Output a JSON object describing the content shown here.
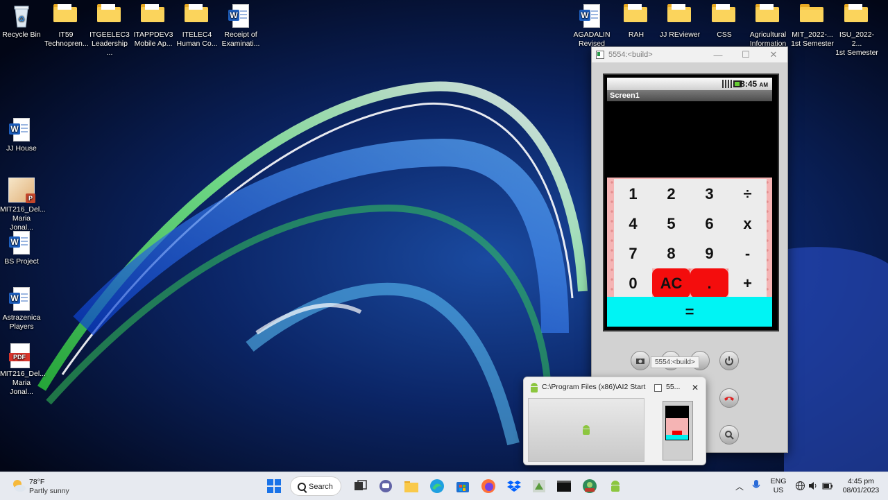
{
  "desktop_icons_top": [
    {
      "label1": "Recycle Bin",
      "label2": "",
      "kind": "bin"
    },
    {
      "label1": "IT59",
      "label2": "Technopren...",
      "kind": "folder"
    },
    {
      "label1": "ITGEELEC3",
      "label2": "Leadership ...",
      "kind": "folder"
    },
    {
      "label1": "ITAPPDEV3",
      "label2": "Mobile Ap...",
      "kind": "folder"
    },
    {
      "label1": "ITELEC4",
      "label2": "Human Co...",
      "kind": "folder"
    },
    {
      "label1": "Receipt of",
      "label2": "Examinati...",
      "kind": "word"
    }
  ],
  "desktop_icons_right": [
    {
      "label1": "AGADALIN",
      "label2": "Revised",
      "kind": "word"
    },
    {
      "label1": "RAH",
      "label2": "",
      "kind": "folder"
    },
    {
      "label1": "JJ REviewer",
      "label2": "",
      "kind": "folder"
    },
    {
      "label1": "CSS",
      "label2": "",
      "kind": "folder"
    },
    {
      "label1": "Agricultural",
      "label2": "Information",
      "kind": "folder"
    },
    {
      "label1": "MIT_2022-...",
      "label2": "1st Semester",
      "kind": "folder"
    },
    {
      "label1": "ISU_2022-2...",
      "label2": "1st Semester",
      "kind": "folder"
    }
  ],
  "desktop_icons_left": [
    {
      "label1": "JJ House",
      "label2": "",
      "kind": "word"
    },
    {
      "label1": "MIT216_Del...",
      "label2": "Maria Jonal...",
      "kind": "ppt"
    },
    {
      "label1": "BS Project",
      "label2": "",
      "kind": "word"
    },
    {
      "label1": "Astrazenica",
      "label2": "Players",
      "kind": "word"
    },
    {
      "label1": "MIT216_Del...",
      "label2": "Maria Jonal...",
      "kind": "pdf"
    }
  ],
  "emulator": {
    "window_title": "5554:<build>",
    "status_time": "8:45",
    "status_ampm": "AM",
    "app_title": "Screen1",
    "keys": [
      "1",
      "2",
      "3",
      "÷",
      "4",
      "5",
      "6",
      "x",
      "7",
      "8",
      "9",
      "-",
      "0",
      "AC",
      ".",
      "+"
    ],
    "equals": "=",
    "tooltip": "5554:<build>"
  },
  "preview": {
    "item1_title": "C:\\Program Files (x86)\\AI2 Start...",
    "item2_title": "55...",
    "close": "✕"
  },
  "weather": {
    "temp": "78°F",
    "desc": "Partly sunny"
  },
  "taskbar": {
    "search_label": "Search"
  },
  "tray": {
    "lang1": "ENG",
    "lang2": "US",
    "time": "4:45 pm",
    "date": "08/01/2023"
  },
  "window_controls": {
    "minimize": "—",
    "maximize": "☐",
    "close": "✕"
  }
}
